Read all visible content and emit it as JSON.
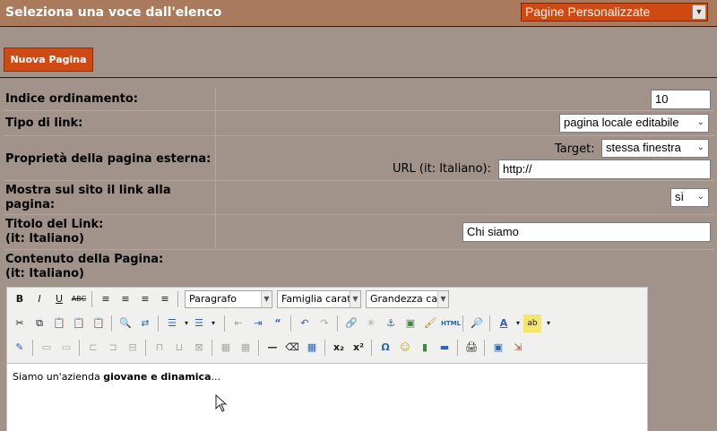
{
  "header": {
    "title": "Seleziona una voce dall'elenco",
    "section_select": "Pagine Personalizzate"
  },
  "new_page_button": "Nuova Pagina",
  "form": {
    "order_index": {
      "label": "Indice ordinamento:",
      "value": "10"
    },
    "link_type": {
      "label": "Tipo di link:",
      "value": "pagina locale editabile"
    },
    "external_page": {
      "label": "Proprietà della pagina esterna:",
      "target_label": "Target:",
      "target_value": "stessa finestra",
      "url_label": "URL (it: Italiano):",
      "url_value": "http://"
    },
    "show_link": {
      "label_line1": "Mostra sul sito il link alla",
      "label_line2": "pagina:",
      "value": "sì"
    },
    "link_title": {
      "label_line1": "Titolo del Link:",
      "label_line2": "(it: Italiano)",
      "value": "Chi siamo"
    },
    "page_content": {
      "label_line1": "Contenuto della Pagina:",
      "label_line2": "(it: Italiano)"
    }
  },
  "editor": {
    "format_combo": "Paragrafo",
    "font_combo": "Famiglia caratt",
    "size_combo": "Grandezza car",
    "content_normal": "Siamo un'azienda ",
    "content_bold": "giovane e dinamica",
    "content_tail": "..."
  },
  "colors": {
    "header_bg": "#a97b5c",
    "page_bg": "#a1928a",
    "accent": "#cf4a12"
  }
}
